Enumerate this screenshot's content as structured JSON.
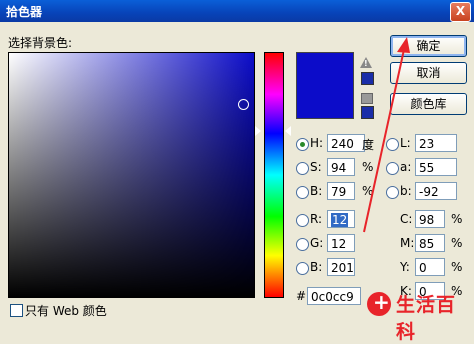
{
  "window": {
    "title": "拾色器",
    "close_glyph": "X"
  },
  "field_label": "选择背景色:",
  "buttons": {
    "ok": "确定",
    "cancel": "取消",
    "libraries": "颜色库"
  },
  "warning_mark": "!",
  "hsb": {
    "h": {
      "label": "H:",
      "value": "240",
      "unit": "度"
    },
    "s": {
      "label": "S:",
      "value": "94",
      "unit": "%"
    },
    "b": {
      "label": "B:",
      "value": "79",
      "unit": "%"
    }
  },
  "lab": {
    "l": {
      "label": "L:",
      "value": "23"
    },
    "a": {
      "label": "a:",
      "value": "55"
    },
    "b": {
      "label": "b:",
      "value": "-92"
    }
  },
  "rgb": {
    "r": {
      "label": "R:",
      "value": "12"
    },
    "g": {
      "label": "G:",
      "value": "12"
    },
    "b": {
      "label": "B:",
      "value": "201"
    }
  },
  "cmyk": {
    "c": {
      "label": "C:",
      "value": "98",
      "unit": "%"
    },
    "m": {
      "label": "M:",
      "value": "85",
      "unit": "%"
    },
    "y": {
      "label": "Y:",
      "value": "0",
      "unit": "%"
    },
    "k": {
      "label": "K:",
      "value": "0",
      "unit": "%"
    }
  },
  "hex": {
    "label": "#",
    "value": "0c0cc9"
  },
  "web_only": {
    "label": "只有 Web 颜色"
  },
  "watermark": "生活百科",
  "colors": {
    "selected": "#0c0cc9",
    "annotation": "#e8242a",
    "titlebar": "#0a4fd0"
  }
}
